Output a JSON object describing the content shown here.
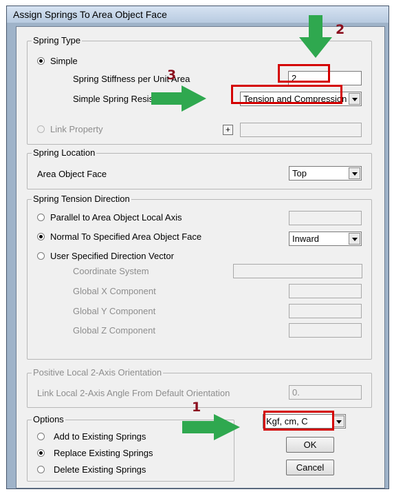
{
  "window": {
    "title": "Assign Springs To Area Object Face"
  },
  "spring_type": {
    "legend": "Spring Type",
    "simple_label": "Simple",
    "stiffness_label": "Spring Stiffness per Unit Area",
    "stiffness_value": "2",
    "resistance_label": "Simple Spring Resistance",
    "resistance_value": "Tension and Compression",
    "link_property_label": "Link Property",
    "link_property_plus": "+",
    "link_property_value": ""
  },
  "spring_location": {
    "legend": "Spring Location",
    "face_label": "Area Object Face",
    "face_value": "Top"
  },
  "tension_direction": {
    "legend": "Spring Tension Direction",
    "parallel_label": "Parallel to Area Object Local Axis",
    "parallel_value": "",
    "normal_label": "Normal To Specified Area Object Face",
    "normal_value": "Inward",
    "user_label": "User Specified Direction Vector",
    "coord_label": "Coordinate System",
    "coord_value": "",
    "gx_label": "Global  X  Component",
    "gy_label": "Global  Y  Component",
    "gz_label": "Global  Z  Component",
    "gx_value": "",
    "gy_value": "",
    "gz_value": ""
  },
  "local_axis": {
    "legend": "Positive Local 2-Axis Orientation",
    "angle_label": "Link Local 2-Axis Angle From Default Orientation",
    "angle_value": "0."
  },
  "options": {
    "legend": "Options",
    "add_label": "Add to Existing Springs",
    "replace_label": "Replace Existing Springs",
    "delete_label": "Delete Existing Springs"
  },
  "units_value": "Kgf, cm, C",
  "ok_label": "OK",
  "cancel_label": "Cancel",
  "annotations": {
    "n1": "1",
    "n2": "2",
    "n3": "3"
  },
  "colors": {
    "highlight": "#d40000",
    "arrow": "#2fa84f",
    "annotation_text": "#8b0f1e"
  }
}
